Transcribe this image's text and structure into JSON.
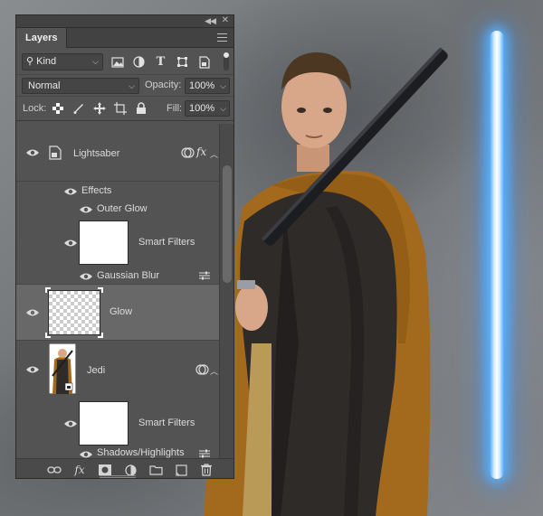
{
  "panel": {
    "tab_label": "Layers",
    "filter": {
      "kind_label": "Kind"
    },
    "blend": {
      "mode": "Normal",
      "opacity_label": "Opacity:",
      "opacity_value": "100%"
    },
    "lock": {
      "label": "Lock:",
      "fill_label": "Fill:",
      "fill_value": "100%"
    }
  },
  "layers": {
    "lightsaber": {
      "name": "Lightsaber",
      "fx": "fx"
    },
    "lightsaber_effects": {
      "label": "Effects"
    },
    "lightsaber_outer_glow": {
      "label": "Outer Glow"
    },
    "lightsaber_smart_filters": {
      "label": "Smart Filters"
    },
    "lightsaber_gaussian_blur": {
      "label": "Gaussian Blur"
    },
    "glow": {
      "name": "Glow"
    },
    "jedi": {
      "name": "Jedi"
    },
    "jedi_smart_filters": {
      "label": "Smart Filters"
    },
    "jedi_partial": {
      "label": "Shadows/Highlights"
    }
  },
  "bottom_bar": {
    "fx_label": "fx"
  },
  "colors": {
    "panel_bg": "#535353",
    "selected_row": "#686868",
    "saber_core": "#ffffff",
    "saber_glow": "#4aa8ff",
    "robe_outer": "#a36a1d",
    "robe_inner": "#2b2826"
  }
}
